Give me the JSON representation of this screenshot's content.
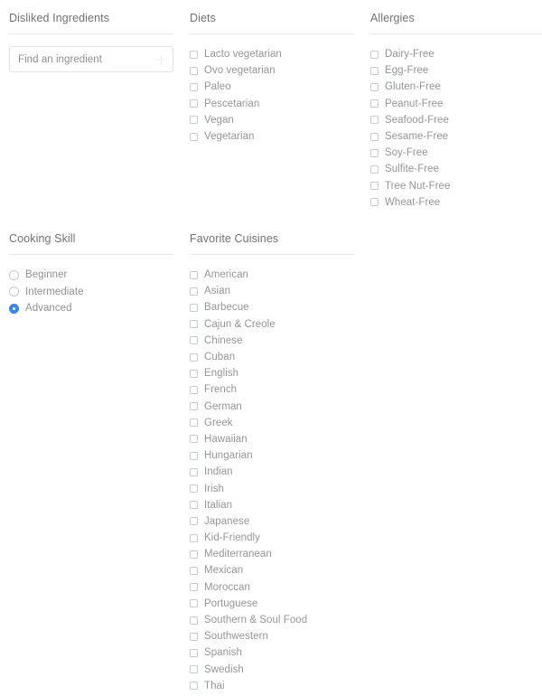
{
  "sections": {
    "disliked_ingredients": {
      "title": "Disliked Ingredients",
      "search": {
        "placeholder": "Find an ingredient",
        "value": "",
        "add_icon": "plus-icon"
      }
    },
    "diets": {
      "title": "Diets",
      "options": [
        {
          "label": "Lacto vegetarian",
          "checked": false
        },
        {
          "label": "Ovo vegetarian",
          "checked": false
        },
        {
          "label": "Paleo",
          "checked": false
        },
        {
          "label": "Pescetarian",
          "checked": false
        },
        {
          "label": "Vegan",
          "checked": false
        },
        {
          "label": "Vegetarian",
          "checked": false
        }
      ]
    },
    "allergies": {
      "title": "Allergies",
      "options": [
        {
          "label": "Dairy-Free",
          "checked": false
        },
        {
          "label": "Egg-Free",
          "checked": false
        },
        {
          "label": "Gluten-Free",
          "checked": false
        },
        {
          "label": "Peanut-Free",
          "checked": false
        },
        {
          "label": "Seafood-Free",
          "checked": false
        },
        {
          "label": "Sesame-Free",
          "checked": false
        },
        {
          "label": "Soy-Free",
          "checked": false
        },
        {
          "label": "Sulfite-Free",
          "checked": false
        },
        {
          "label": "Tree Nut-Free",
          "checked": false
        },
        {
          "label": "Wheat-Free",
          "checked": false
        }
      ]
    },
    "cooking_skill": {
      "title": "Cooking Skill",
      "selected": "Advanced",
      "options": [
        {
          "label": "Beginner",
          "checked": false
        },
        {
          "label": "Intermediate",
          "checked": false
        },
        {
          "label": "Advanced",
          "checked": true
        }
      ]
    },
    "favorite_cuisines": {
      "title": "Favorite Cuisines",
      "options": [
        {
          "label": "American",
          "checked": false
        },
        {
          "label": "Asian",
          "checked": false
        },
        {
          "label": "Barbecue",
          "checked": false
        },
        {
          "label": "Cajun & Creole",
          "checked": false
        },
        {
          "label": "Chinese",
          "checked": false
        },
        {
          "label": "Cuban",
          "checked": false
        },
        {
          "label": "English",
          "checked": false
        },
        {
          "label": "French",
          "checked": false
        },
        {
          "label": "German",
          "checked": false
        },
        {
          "label": "Greek",
          "checked": false
        },
        {
          "label": "Hawaiian",
          "checked": false
        },
        {
          "label": "Hungarian",
          "checked": false
        },
        {
          "label": "Indian",
          "checked": false
        },
        {
          "label": "Irish",
          "checked": false
        },
        {
          "label": "Italian",
          "checked": false
        },
        {
          "label": "Japanese",
          "checked": false
        },
        {
          "label": "Kid-Friendly",
          "checked": false
        },
        {
          "label": "Mediterranean",
          "checked": false
        },
        {
          "label": "Mexican",
          "checked": false
        },
        {
          "label": "Moroccan",
          "checked": false
        },
        {
          "label": "Portuguese",
          "checked": false
        },
        {
          "label": "Southern & Soul Food",
          "checked": false
        },
        {
          "label": "Southwestern",
          "checked": false
        },
        {
          "label": "Spanish",
          "checked": false
        },
        {
          "label": "Swedish",
          "checked": false
        },
        {
          "label": "Thai",
          "checked": false
        }
      ]
    }
  },
  "colors": {
    "accent": "#3b84f0",
    "title_text": "#6f7277",
    "label_text": "#939699",
    "divider": "#e9eaec",
    "control_border": "#c8cbcf",
    "input_border": "#dfe1e4",
    "background": "#ffffff"
  }
}
